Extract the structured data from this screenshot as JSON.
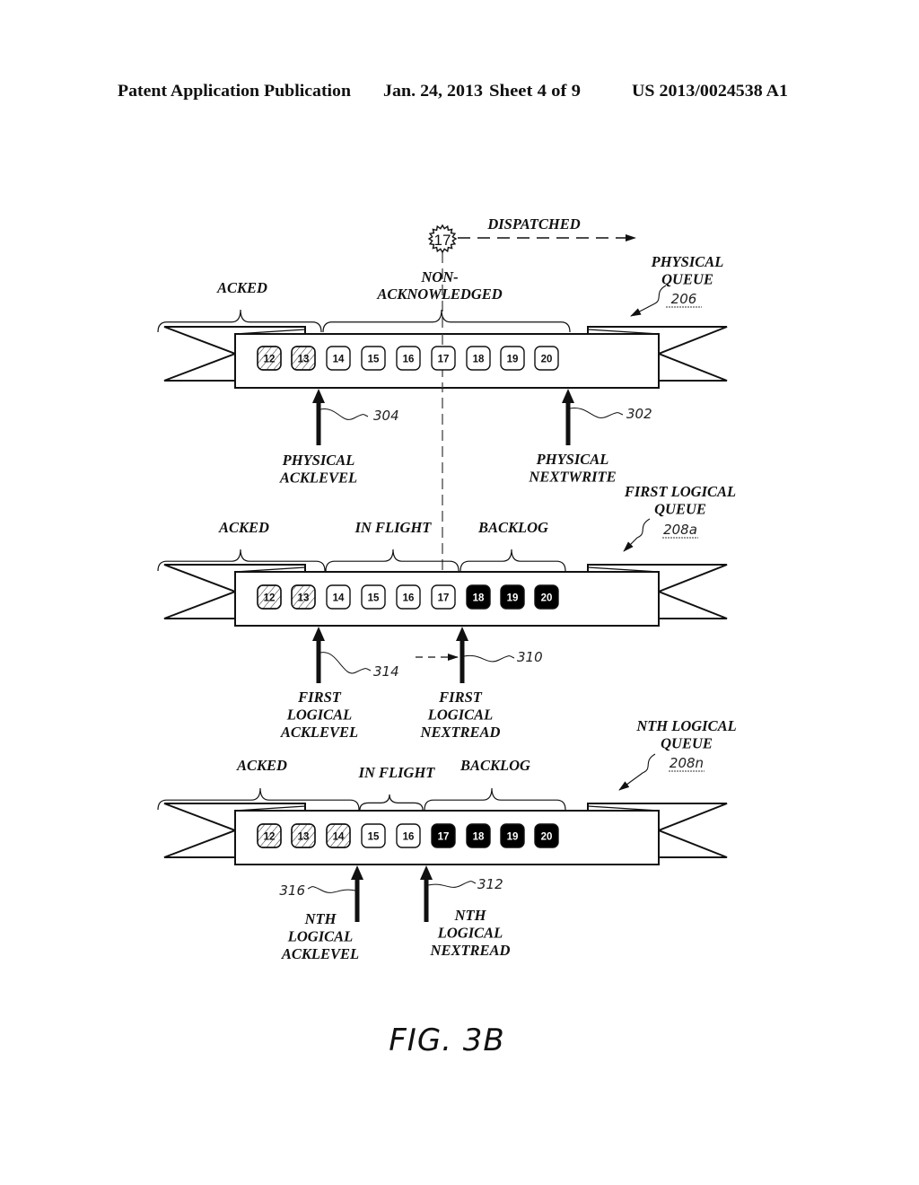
{
  "header": {
    "publication": "Patent Application Publication",
    "date": "Jan. 24, 2013",
    "sheet": "Sheet 4 of 9",
    "number": "US 2013/0024538 A1"
  },
  "dispatched": {
    "item": "17",
    "label": "DISPATCHED"
  },
  "queues": [
    {
      "title": [
        "PHYSICAL",
        "QUEUE"
      ],
      "ref": "206",
      "segments": [
        {
          "lines": [
            "ACKED"
          ]
        },
        {
          "lines": [
            "NON-",
            "ACKNOWLEDGED"
          ]
        }
      ],
      "cells": [
        {
          "n": "12",
          "state": "acked"
        },
        {
          "n": "13",
          "state": "acked"
        },
        {
          "n": "14",
          "state": "pending"
        },
        {
          "n": "15",
          "state": "pending"
        },
        {
          "n": "16",
          "state": "pending"
        },
        {
          "n": "17",
          "state": "pending"
        },
        {
          "n": "18",
          "state": "pending"
        },
        {
          "n": "19",
          "state": "pending"
        },
        {
          "n": "20",
          "state": "pending"
        }
      ],
      "pointers": [
        {
          "lines": [
            "PHYSICAL",
            "ACKLEVEL"
          ],
          "ref": "304"
        },
        {
          "lines": [
            "PHYSICAL",
            "NEXTWRITE"
          ],
          "ref": "302"
        }
      ]
    },
    {
      "title": [
        "FIRST LOGICAL",
        "QUEUE"
      ],
      "ref": "208a",
      "segments": [
        {
          "lines": [
            "ACKED"
          ]
        },
        {
          "lines": [
            "IN FLIGHT"
          ]
        },
        {
          "lines": [
            "BACKLOG"
          ]
        }
      ],
      "cells": [
        {
          "n": "12",
          "state": "acked"
        },
        {
          "n": "13",
          "state": "acked"
        },
        {
          "n": "14",
          "state": "pending"
        },
        {
          "n": "15",
          "state": "pending"
        },
        {
          "n": "16",
          "state": "pending"
        },
        {
          "n": "17",
          "state": "pending"
        },
        {
          "n": "18",
          "state": "backlog"
        },
        {
          "n": "19",
          "state": "backlog"
        },
        {
          "n": "20",
          "state": "backlog"
        }
      ],
      "pointers": [
        {
          "lines": [
            "FIRST",
            "LOGICAL",
            "ACKLEVEL"
          ],
          "ref": "314"
        },
        {
          "lines": [
            "FIRST",
            "LOGICAL",
            "NEXTREAD"
          ],
          "ref": "310"
        }
      ]
    },
    {
      "title": [
        "NTH LOGICAL",
        "QUEUE"
      ],
      "ref": "208n",
      "segments": [
        {
          "lines": [
            "ACKED"
          ]
        },
        {
          "lines": [
            "IN FLIGHT"
          ]
        },
        {
          "lines": [
            "BACKLOG"
          ]
        }
      ],
      "cells": [
        {
          "n": "12",
          "state": "acked"
        },
        {
          "n": "13",
          "state": "acked"
        },
        {
          "n": "14",
          "state": "acked"
        },
        {
          "n": "15",
          "state": "pending"
        },
        {
          "n": "16",
          "state": "pending"
        },
        {
          "n": "17",
          "state": "backlog"
        },
        {
          "n": "18",
          "state": "backlog"
        },
        {
          "n": "19",
          "state": "backlog"
        },
        {
          "n": "20",
          "state": "backlog"
        }
      ],
      "pointers": [
        {
          "lines": [
            "NTH",
            "LOGICAL",
            "ACKLEVEL"
          ],
          "ref": "316"
        },
        {
          "lines": [
            "NTH",
            "LOGICAL",
            "NEXTREAD"
          ],
          "ref": "312"
        }
      ]
    }
  ],
  "caption": "FIG. 3B",
  "colors": {
    "ink": "#111111",
    "paper": "#ffffff",
    "backlog_fill": "#000000"
  }
}
